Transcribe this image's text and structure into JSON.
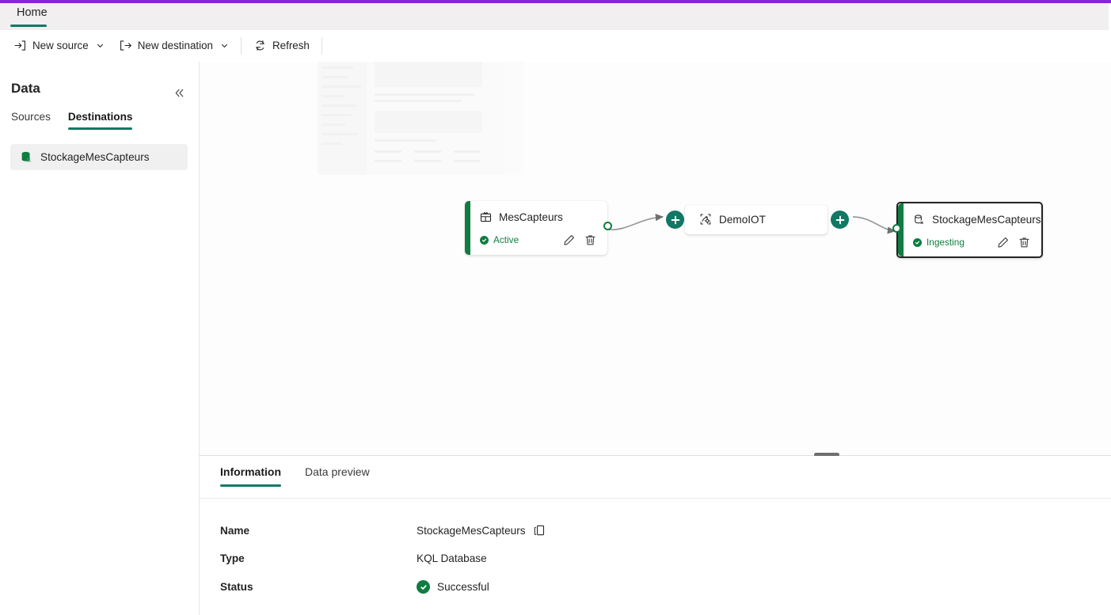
{
  "theme": {
    "accent_purple": "#8b21d9",
    "teal": "#117865",
    "green": "#107c41",
    "header_bg": "#f1eff0",
    "canvas_bg": "#fdfdfd"
  },
  "header": {
    "tab_home": "Home"
  },
  "toolbar": {
    "new_source": "New source",
    "new_destination": "New destination",
    "refresh": "Refresh"
  },
  "sidebar": {
    "title": "Data",
    "collapse_icon": "chevron-double-left-icon",
    "tabs": [
      {
        "label": "Sources",
        "active": false
      },
      {
        "label": "Destinations",
        "active": true
      }
    ],
    "destinations": [
      {
        "label": "StockageMesCapteurs",
        "icon": "database-icon",
        "selected": true
      }
    ]
  },
  "canvas": {
    "nodes": [
      {
        "id": "source",
        "title": "MesCapteurs",
        "icon": "eventstream-icon",
        "status": "Active",
        "edit_icon": "pencil-icon",
        "delete_icon": "trash-icon"
      },
      {
        "id": "processor",
        "title": "DemoIOT",
        "icon": "event-processor-icon"
      },
      {
        "id": "destination",
        "title": "StockageMesCapteurs",
        "icon": "database-icon",
        "status": "Ingesting",
        "edit_icon": "pencil-icon",
        "delete_icon": "trash-icon",
        "selected": true
      }
    ],
    "add_buttons": [
      {
        "id": "add-after-source",
        "icon": "plus-icon"
      },
      {
        "id": "add-after-processor",
        "icon": "plus-icon"
      }
    ]
  },
  "details": {
    "tabs": [
      {
        "label": "Information",
        "active": true
      },
      {
        "label": "Data preview",
        "active": false
      }
    ],
    "rows": [
      {
        "key": "Name",
        "value": "StockageMesCapteurs",
        "copy": true
      },
      {
        "key": "Type",
        "value": "KQL Database",
        "copy": false
      },
      {
        "key": "Status",
        "value": "Successful",
        "copy": false,
        "status_icon": "check-circle-icon"
      }
    ]
  }
}
